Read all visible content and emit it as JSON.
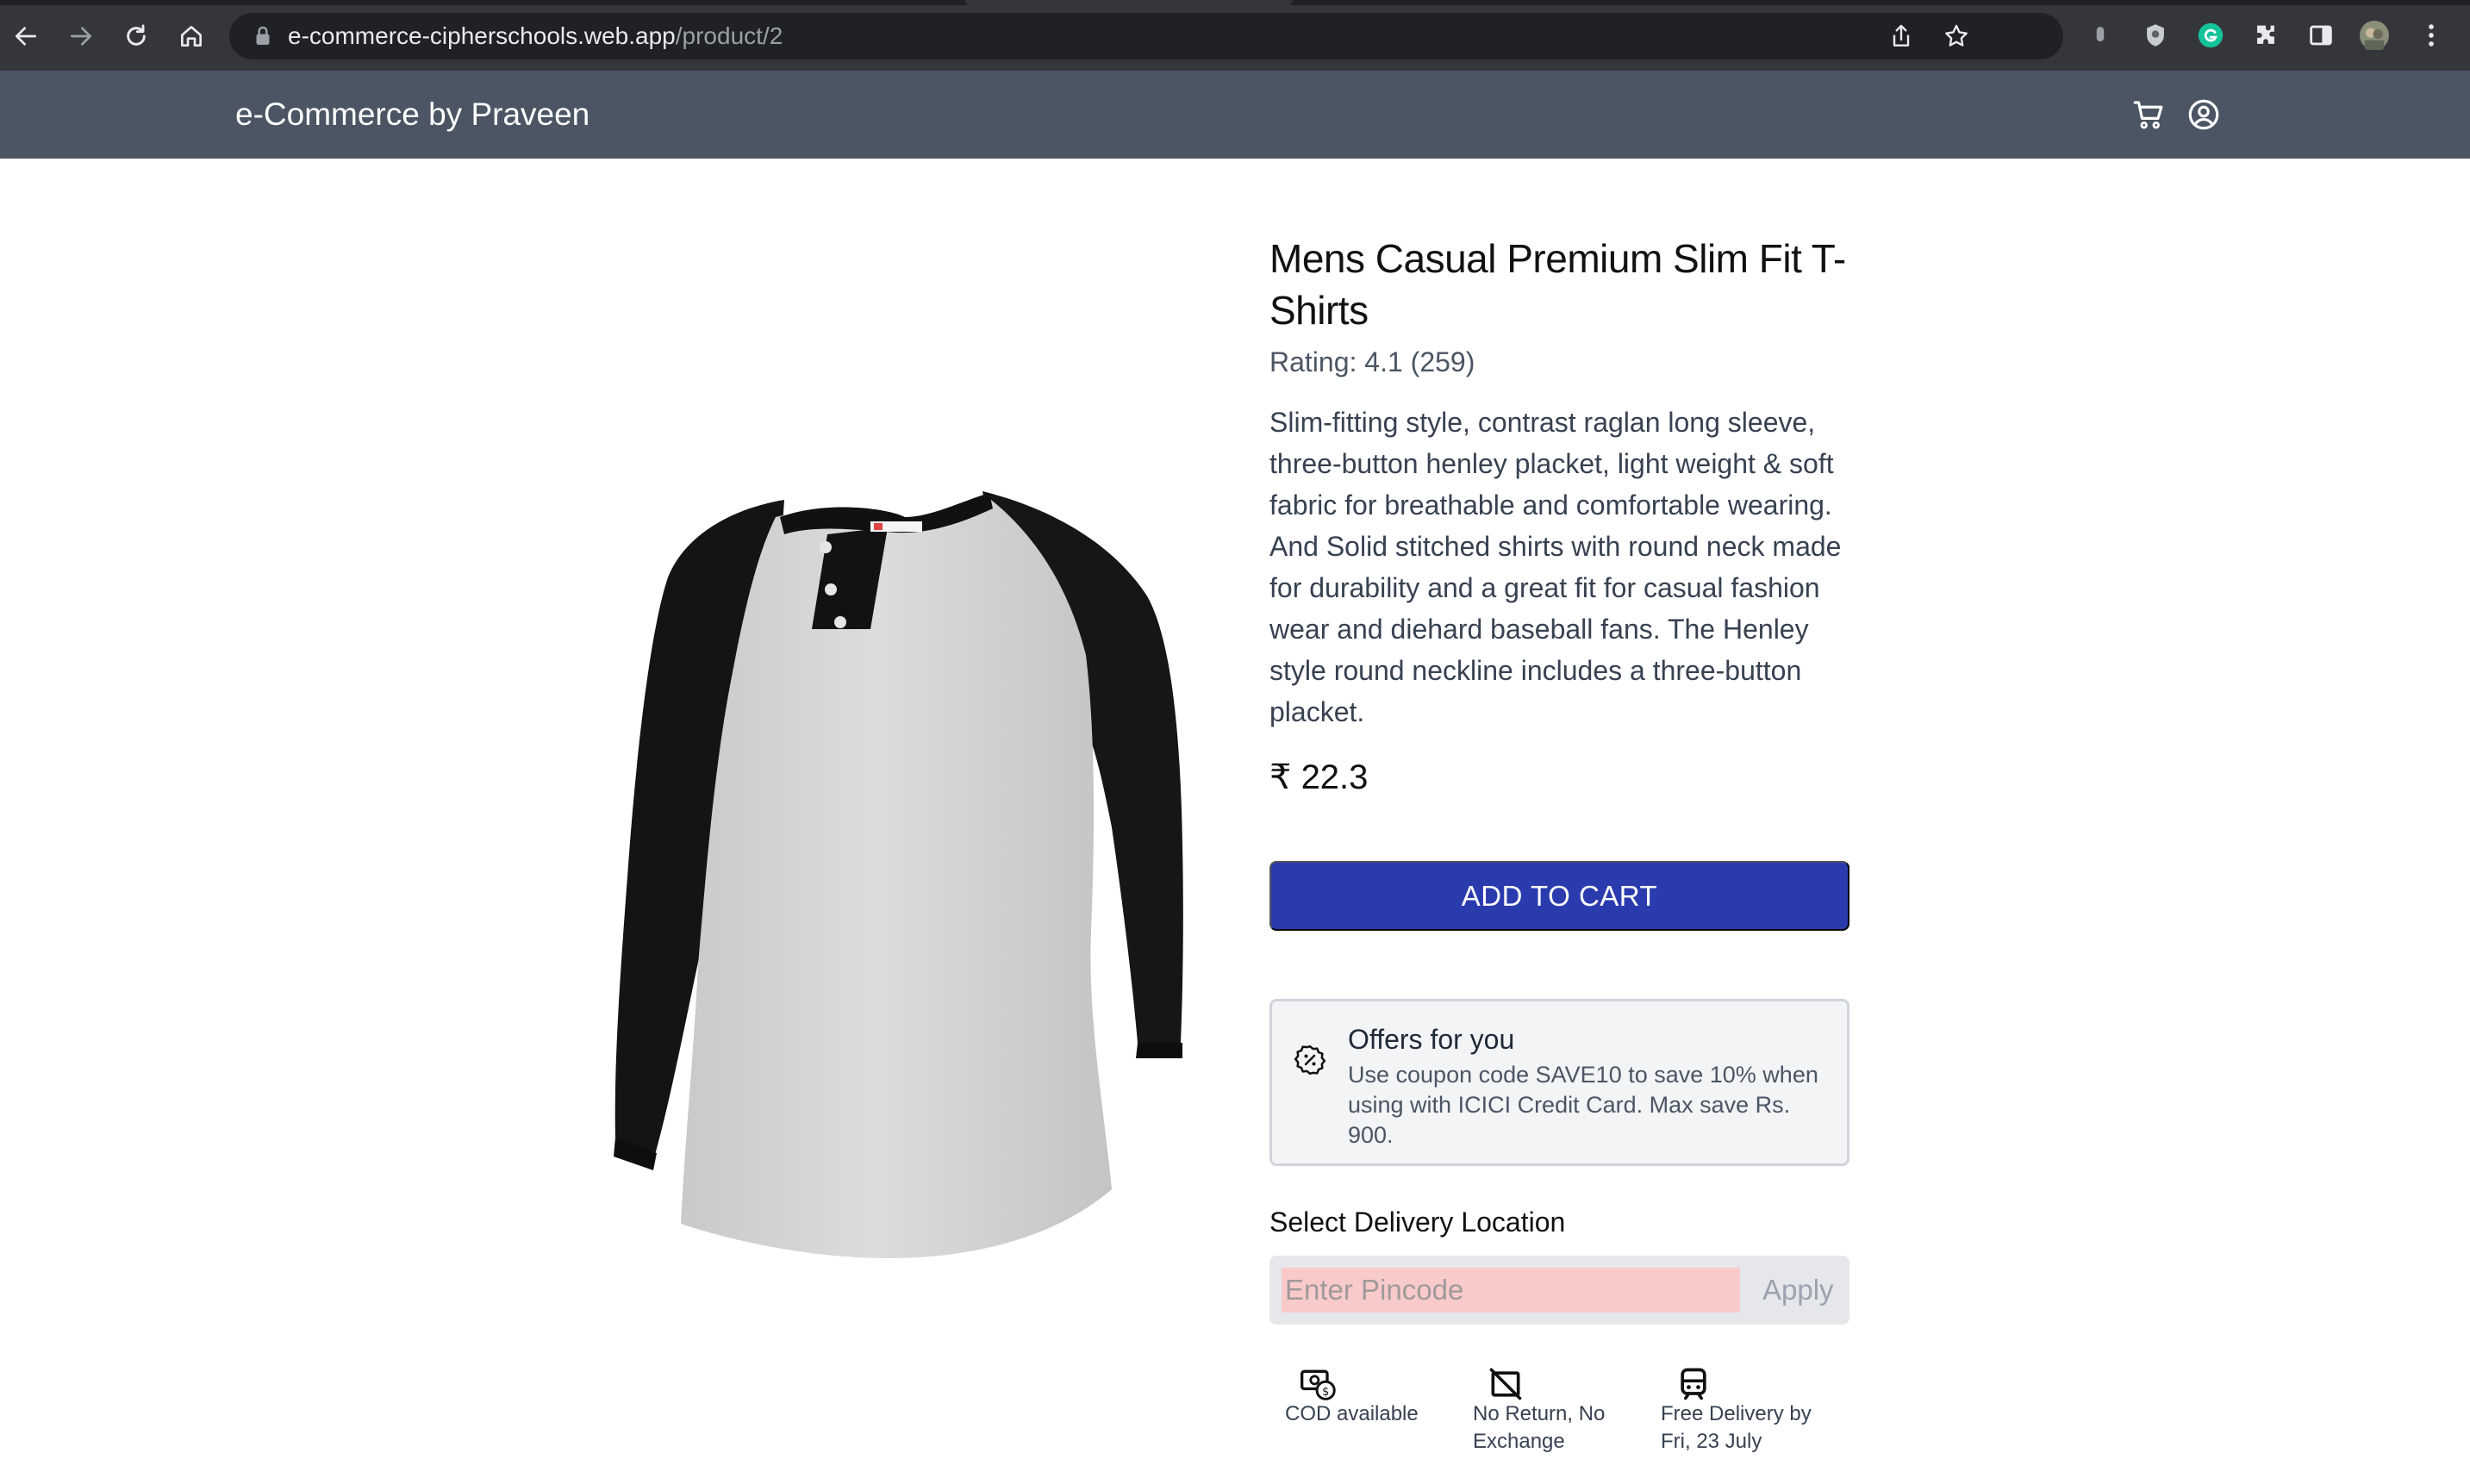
{
  "browser": {
    "url_host": "e-commerce-cipherschools.web.app",
    "url_path": "/product/2"
  },
  "navbar": {
    "brand": "e-Commerce by Praveen"
  },
  "product": {
    "title": "Mens Casual Premium Slim Fit T-Shirts",
    "rating_text": "Rating: 4.1 (259)",
    "description": "Slim-fitting style, contrast raglan long sleeve, three-button henley placket, light weight & soft fabric for breathable and comfortable wearing. And Solid stitched shirts with round neck made for durability and a great fit for casual fashion wear and diehard baseball fans. The Henley style round neckline includes a three-button placket.",
    "price": "₹ 22.3",
    "add_to_cart_label": "ADD TO CART"
  },
  "offers": {
    "title": "Offers for you",
    "text": "Use coupon code SAVE10 to save 10% when using with ICICI Credit Card. Max save Rs. 900."
  },
  "delivery": {
    "label": "Select Delivery Location",
    "pincode_placeholder": "Enter Pincode",
    "apply_label": "Apply"
  },
  "features": [
    {
      "icon": "cash-icon",
      "text": "COD available"
    },
    {
      "icon": "no-return-icon",
      "text": "No Return, No Exchange"
    },
    {
      "icon": "delivery-truck-icon",
      "text": "Free Delivery by Fri, 23 July"
    }
  ],
  "colors": {
    "chrome_bg": "#35363a",
    "navbar_bg": "#4b5563",
    "primary_button": "#2a3bae",
    "pincode_input_bg": "#f9caca"
  }
}
